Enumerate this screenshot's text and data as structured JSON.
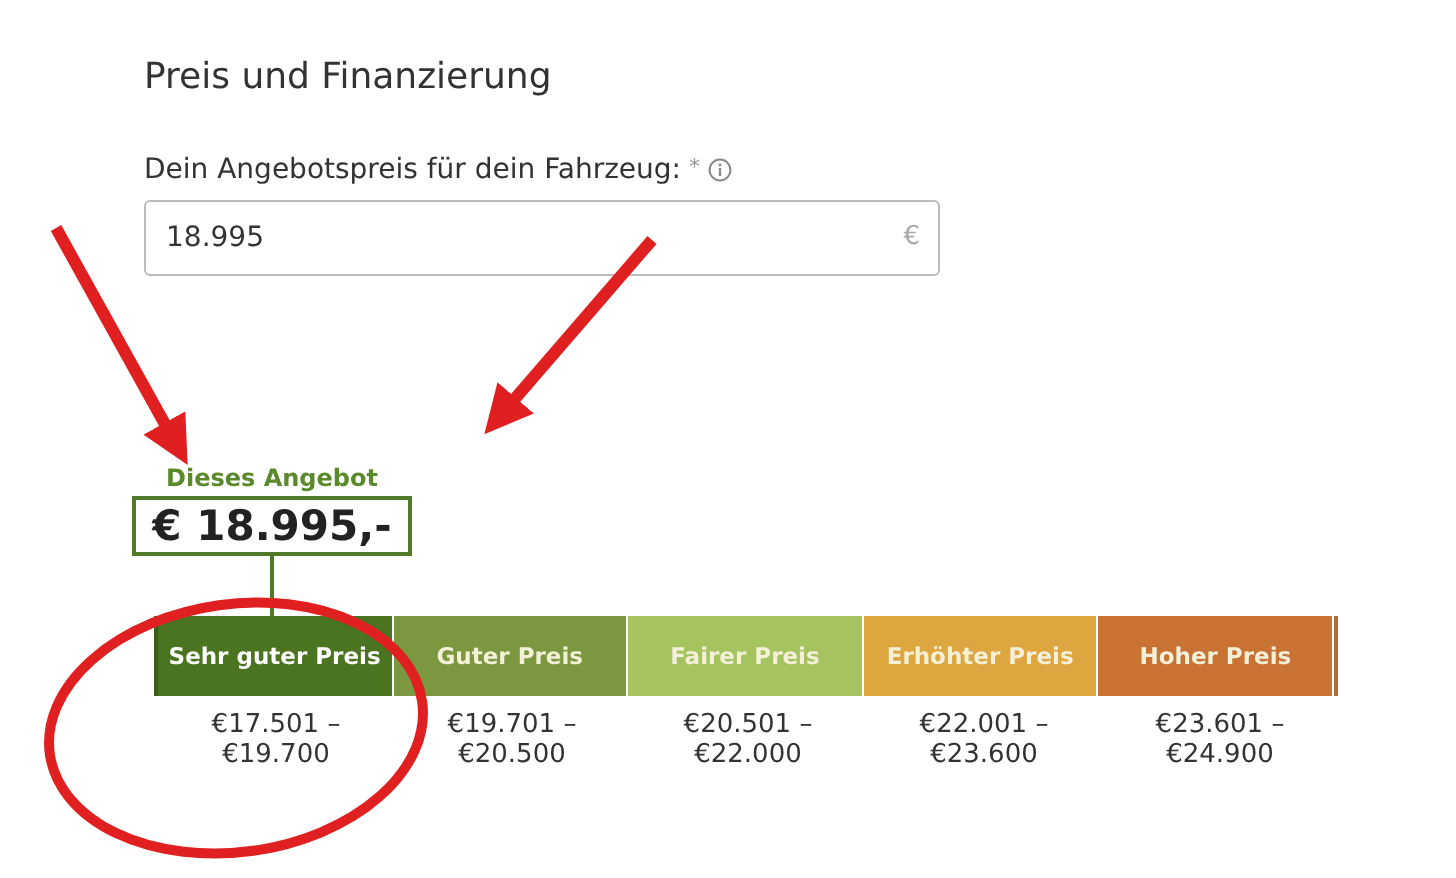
{
  "section_title": "Preis und Finanzierung",
  "price_field": {
    "label": "Dein Angebotspreis für dein Fahrzeug:",
    "required_mark": "*",
    "value": "18.995",
    "unit": "€"
  },
  "offer_marker": {
    "caption": "Dieses Angebot",
    "price": "€ 18.995,-"
  },
  "price_scale": [
    {
      "label": "Sehr guter Preis",
      "color": "#4a7420",
      "range_from": "€17.501 –",
      "range_to": "€19.700",
      "selected": true
    },
    {
      "label": "Guter Preis",
      "color": "#7b973f",
      "range_from": "€19.701 –",
      "range_to": "€20.500",
      "selected": false
    },
    {
      "label": "Fairer Preis",
      "color": "#a5c35f",
      "range_from": "€20.501 –",
      "range_to": "€22.000",
      "selected": false
    },
    {
      "label": "Erhöhter Preis",
      "color": "#dda63e",
      "range_from": "€22.001 –",
      "range_to": "€23.600",
      "selected": false
    },
    {
      "label": "Hoher Preis",
      "color": "#c87234",
      "range_from": "€23.601 –",
      "range_to": "€24.900",
      "selected": false
    }
  ]
}
